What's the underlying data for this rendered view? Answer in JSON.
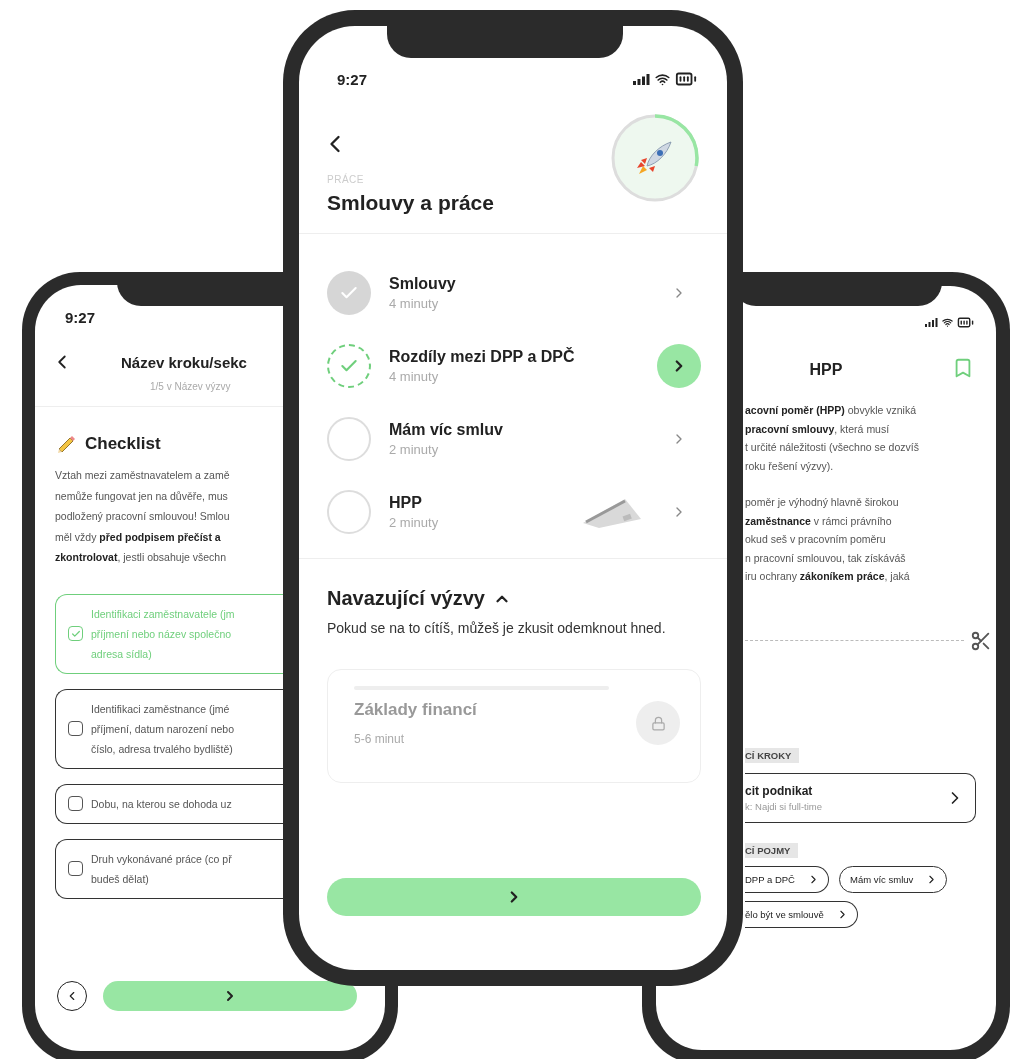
{
  "left_screen": {
    "status_time": "9:27",
    "title": "Název kroku/sekc",
    "subtitle": "1/5 v Název výzvy",
    "section_title": "Checklist",
    "paragraph_lines": [
      "Vztah mezi zaměstnavatelem a zamě",
      "nemůže fungovat jen na důvěře, mus",
      "podložený pracovní smlouvou! Smlou",
      "měl vždy **před podpisem přečíst a**",
      "**zkontrolovat**, jestli obsahuje všechn"
    ],
    "checklist": [
      {
        "lines": [
          "Identifikaci zaměstnavatele (jm",
          "příjmení nebo název společno",
          "adresa sídla)"
        ],
        "checked": true
      },
      {
        "lines": [
          "Identifikaci zaměstnance (jmé",
          "příjmení, datum narození nebo",
          "číslo, adresa trvalého bydliště)"
        ],
        "checked": false
      },
      {
        "lines": [
          "Dobu, na kterou se dohoda uz"
        ],
        "checked": false
      },
      {
        "lines": [
          "Druh vykonávané práce (co př",
          "budeš dělat)"
        ],
        "checked": false
      }
    ]
  },
  "center_screen": {
    "status_time": "9:27",
    "category": "PRÁCE",
    "title": "Smlouvy a práce",
    "progress": {
      "level": 0.28
    },
    "lessons": [
      {
        "title": "Smlouvy",
        "duration": "4 minuty",
        "kind": "done",
        "illustration": false
      },
      {
        "title": "Rozdíly mezi DPP a DPČ",
        "duration": "4 minuty",
        "kind": "current",
        "illustration": false
      },
      {
        "title": "Mám víc smluv",
        "duration": "2 minuty",
        "kind": "todo",
        "illustration": false
      },
      {
        "title": "HPP",
        "duration": "2 minuty",
        "kind": "todo",
        "illustration": true
      }
    ],
    "followups": {
      "title": "Navazující výzvy",
      "expanded": true,
      "description": "Pokud se na to cítíš, můžeš je zkusit odemknout hned.",
      "cards": [
        {
          "title": "Základy financí",
          "duration": "5-6 minut",
          "locked": true
        }
      ]
    }
  },
  "right_screen": {
    "title": "HPP",
    "paragraphs": [
      [
        "**acovní poměr (HPP)** obvykle vzniká",
        "**pracovní smlouvy**, která musí",
        "t určité náležitosti (všechno se dozvíš",
        "roku řešení výzvy)."
      ],
      [
        "poměr je výhodný hlavně širokou",
        "**zaměstnance** v rámci právního",
        "okud seš v pracovním poměru",
        "n pracovní smlouvou, tak získáváš",
        "iru ochrany **zákoníkem práce**, jaká"
      ]
    ],
    "steps_label": "CÍ KROKY",
    "step": {
      "title": "cit podnikat",
      "subtitle": "k: Najdi si full-time"
    },
    "terms_label": "CÍ POJMY",
    "terms": [
      [
        "DPP a DPČ",
        "Mám víc smluv"
      ],
      [
        "ělo být ve smlouvě"
      ]
    ]
  }
}
